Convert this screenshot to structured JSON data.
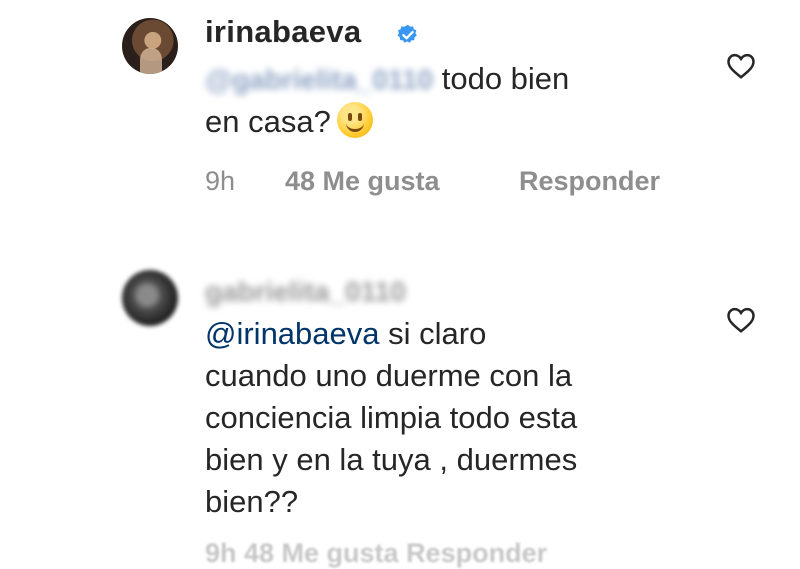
{
  "comments": [
    {
      "username": "irinabaeva",
      "verified": true,
      "mention_blurred": "@gabrielita_0110",
      "text_line1": "todo bien",
      "text_line2": "en casa?",
      "emoji": "slightly-smiling-face",
      "time": "9h",
      "likes": "48 Me gusta",
      "reply": "Responder"
    },
    {
      "username_blurred": "gabrielita_0110",
      "mention": "@irinabaeva",
      "text_line1": "si claro",
      "text_line2": "cuando uno duerme con la",
      "text_line3": "conciencia limpia todo esta",
      "text_line4": "bien y en la tuya , duermes",
      "text_line5": "bien??",
      "meta_cut": "9h   48 Me gusta   Responder"
    }
  ],
  "colors": {
    "text": "#262626",
    "meta": "#8e8e8e",
    "mention": "#003569",
    "verified": "#3897f0"
  }
}
